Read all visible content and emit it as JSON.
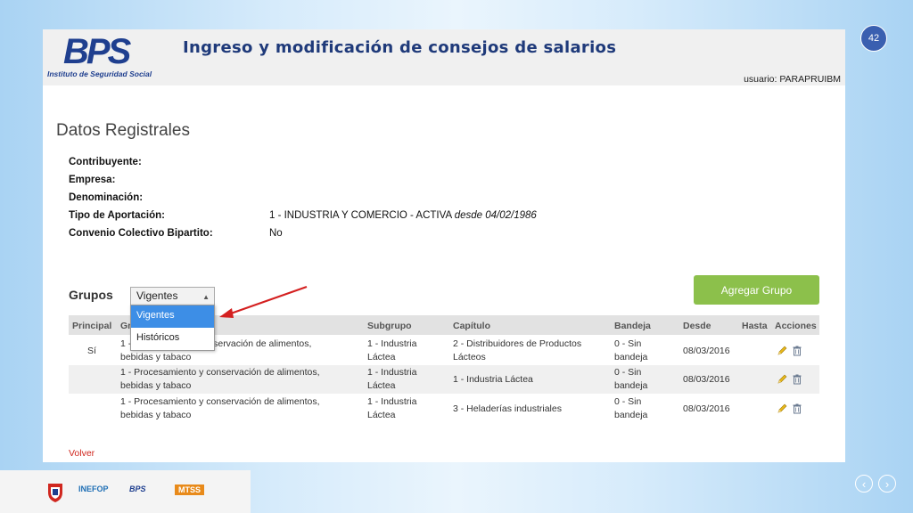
{
  "slide": {
    "number": "42"
  },
  "header": {
    "logo_text": "BPS",
    "logo_subtitle": "Instituto de Seguridad Social",
    "title": "Ingreso y modificación de consejos de salarios",
    "user": "usuario: PARAPRUIBM"
  },
  "section": {
    "title": "Datos Registrales"
  },
  "fields": [
    {
      "label": "Contribuyente:",
      "value": ""
    },
    {
      "label": "Empresa:",
      "value": ""
    },
    {
      "label": "Denominación:",
      "value": ""
    },
    {
      "label": "Tipo de Aportación:",
      "value": "1 - INDUSTRIA Y COMERCIO - ACTIVA ",
      "value_italic": "desde 04/02/1986"
    },
    {
      "label": "Convenio Colectivo Bipartito:",
      "value": "No"
    }
  ],
  "grupos": {
    "label": "Grupos",
    "selected": "Vigentes",
    "options": [
      "Vigentes",
      "Históricos"
    ],
    "add_button": "Agregar Grupo"
  },
  "table": {
    "headers": {
      "principal": "Principal",
      "grupo": "Gr",
      "subgrupo": "Subgrupo",
      "capitulo": "Capítulo",
      "bandeja": "Bandeja",
      "desde": "Desde",
      "hasta": "Hasta",
      "acciones": "Acciones"
    },
    "rows": [
      {
        "principal": "Sí",
        "grupo_line1": "1 - ",
        "grupo_line1_tail": "conservación de alimentos,",
        "grupo_line2": "bebidas y tabaco",
        "subgrupo_line1": "1 - Industria",
        "subgrupo_line2": "Láctea",
        "capitulo_line1": "2 - Distribuidores de Productos",
        "capitulo_line2": "Lácteos",
        "bandeja_line1": "0 - Sin",
        "bandeja_line2": "bandeja",
        "desde": "08/03/2016",
        "hasta": ""
      },
      {
        "principal": "",
        "grupo_line1": "1 - Procesamiento y conservación de alimentos,",
        "grupo_line1_tail": "",
        "grupo_line2": "bebidas y tabaco",
        "subgrupo_line1": "1 - Industria",
        "subgrupo_line2": "Láctea",
        "capitulo_line1": "1 - Industria Láctea",
        "capitulo_line2": "",
        "bandeja_line1": "0 - Sin",
        "bandeja_line2": "bandeja",
        "desde": "08/03/2016",
        "hasta": ""
      },
      {
        "principal": "",
        "grupo_line1": "1 - Procesamiento y conservación de alimentos,",
        "grupo_line1_tail": "",
        "grupo_line2": "bebidas y tabaco",
        "subgrupo_line1": "1 - Industria",
        "subgrupo_line2": "Láctea",
        "capitulo_line1": "3 - Heladerías industriales",
        "capitulo_line2": "",
        "bandeja_line1": "0 - Sin",
        "bandeja_line2": "bandeja",
        "desde": "08/03/2016",
        "hasta": ""
      }
    ]
  },
  "volver": "Volver",
  "footer": {
    "logos": [
      "INEFOP",
      "BPS",
      "MTSS"
    ]
  },
  "icons": {
    "edit": "pencil-icon",
    "delete": "trash-icon",
    "prev": "chevron-left-icon",
    "next": "chevron-right-icon"
  },
  "colors": {
    "primary_blue": "#1f3f8f",
    "add_button": "#8cc04b",
    "selected_option": "#3d8ee6",
    "volver_link": "#d0271f",
    "arrow": "#d42020"
  }
}
